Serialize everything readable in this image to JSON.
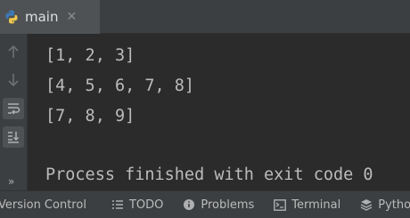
{
  "run_tab": {
    "label": "main",
    "close_glyph": "✕",
    "icon": "python-icon"
  },
  "toolbar": {
    "buttons": [
      "arrow-up-icon",
      "arrow-down-icon",
      "soft-wrap-icon",
      "scroll-to-end-icon"
    ],
    "more_glyph": "»"
  },
  "console": {
    "lines": [
      "[1, 2, 3]",
      "[4, 5, 6, 7, 8]",
      "[7, 8, 9]",
      "",
      "Process finished with exit code 0"
    ]
  },
  "bottom_bar": {
    "items": [
      "Version Control",
      "TODO",
      "Problems",
      "Terminal",
      "Python"
    ]
  },
  "colors": {
    "background": "#2b2b2b",
    "panel": "#3c3f41",
    "text": "#bbbbbb"
  }
}
